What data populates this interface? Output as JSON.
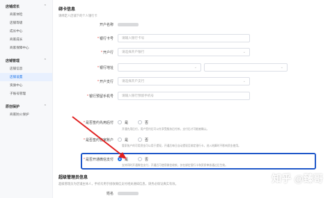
{
  "sidebar": {
    "groups": [
      {
        "label": "店铺成长",
        "items": [
          "商家体检",
          "店铺等级",
          "成长中心",
          "商家成长",
          "商家保障中心"
        ]
      },
      {
        "label": "店铺管理",
        "items": [
          "店铺信息",
          "店铺设置",
          "资质中心",
          "子账号管理"
        ]
      },
      {
        "label": "原创保护",
        "items": [
          "商家防火保护"
        ]
      }
    ],
    "active_item": "店铺设置"
  },
  "bind_card": {
    "title": "绑卡信息",
    "desc": "请绑定人店铺下的个人银行卡"
  },
  "fields": {
    "account_name_label": "开户名称",
    "card_number_label": "银行卡号",
    "card_number_placeholder": "请输入银行卡号",
    "bank_label": "开户行",
    "bank_placeholder": "请选择开户银行",
    "bank_region_label": "银行地址",
    "branch_label": "开户支行",
    "branch_placeholder": "请选择开户支行",
    "phone_label": "银行预留手机号",
    "phone_placeholder": "请输入银行预留手机号"
  },
  "questions": {
    "q1_label": "是否签约先用后付",
    "q1_yes": "是",
    "q1_no": "否",
    "q1_note": "开通先用后付，用户签约后可以先享受服务后付款，支付后才可能被确认。",
    "q2_label": "是否签约管家账户",
    "q2_yes": "是",
    "q2_no": "否",
    "q2_note": "管家账户的可用资金可以用于提现，开通后每日自动提现至绑定银行卡，进入结算时不影响资金使用。",
    "q3_label": "是否开通微信支付",
    "q3_yes": "是",
    "q3_no": "否",
    "q3_note": "支持同时开通微信支付，开通后可使用微信收款，仅在绑定银行卡和资质审核通过后生效。"
  },
  "admin": {
    "title": "超级管理员信息",
    "desc": "超级管理员为店铺主体人，手机号用于接收微信支付相关通知信息，请务必保证真实有效。",
    "name_label": "姓名"
  },
  "watermark": {
    "brand": "知乎",
    "author": "@臻哥"
  }
}
